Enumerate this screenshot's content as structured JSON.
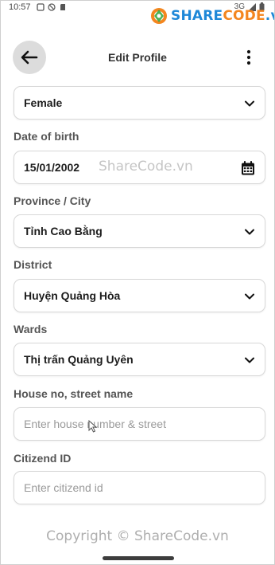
{
  "status_bar": {
    "time": "10:57",
    "network": "3G"
  },
  "watermark": {
    "logo_part1": "SHARE",
    "logo_part2": "CODE",
    "logo_part3": ".vn",
    "middle": "ShareCode.vn",
    "bottom": "Copyright © ShareCode.vn"
  },
  "header": {
    "title": "Edit Profile"
  },
  "form": {
    "gender_value": "Female",
    "dob_label": "Date of birth",
    "dob_value": "15/01/2002",
    "province_label": "Province / City",
    "province_value": "Tỉnh Cao Bằng",
    "district_label": "District",
    "district_value": "Huyện Quảng Hòa",
    "wards_label": "Wards",
    "wards_value": "Thị trấn Quảng Uyên",
    "house_label": "House no, street name",
    "house_placeholder": "Enter house number & street",
    "citizen_label": "Citizend ID",
    "citizen_placeholder": "Enter citizend id"
  },
  "colors": {
    "logo_blue": "#1e88d8",
    "logo_orange": "#f4861f",
    "back_button_bg": "#dcdcdc"
  }
}
